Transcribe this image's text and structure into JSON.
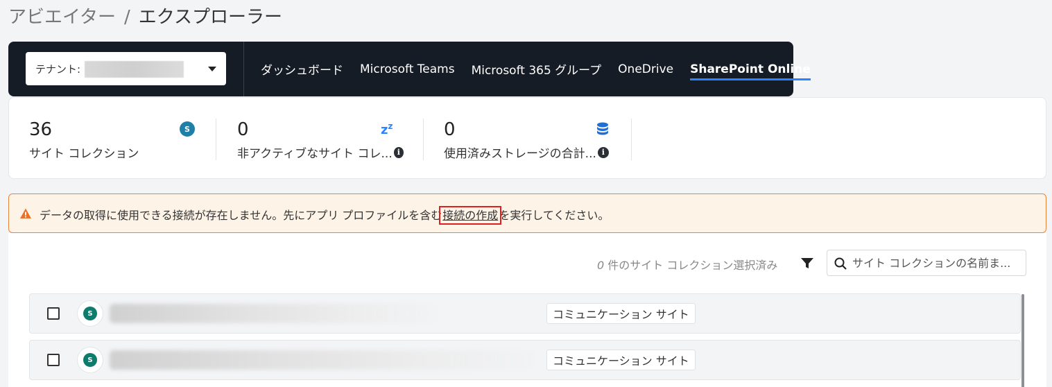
{
  "breadcrumb": {
    "parent": "アビエイター",
    "separator": "/",
    "current": "エクスプローラー"
  },
  "tenant": {
    "label": "テナント:",
    "value": ""
  },
  "nav": {
    "tabs": [
      {
        "label": "ダッシュボード",
        "active": false
      },
      {
        "label": "Microsoft Teams",
        "active": false
      },
      {
        "label": "Microsoft 365 グループ",
        "active": false
      },
      {
        "label": "OneDrive",
        "active": false
      },
      {
        "label": "SharePoint Online",
        "active": true
      }
    ]
  },
  "stats": [
    {
      "value": "36",
      "label": "サイト コレクション",
      "icon": "sharepoint-icon",
      "info": false
    },
    {
      "value": "0",
      "label": "非アクティブなサイト コレ...",
      "icon": "sleep-icon",
      "info": true
    },
    {
      "value": "0",
      "label": "使用済みストレージの合計...",
      "icon": "database-icon",
      "info": true
    }
  ],
  "alert": {
    "text_before": "データの取得に使用できる接続が存在しません。先にアプリ プロファイルを含む",
    "link": "接続の作成",
    "text_after": "を実行してください。"
  },
  "toolbar": {
    "selected_count": "0",
    "selected_suffix": "件のサイト コレクション選択済み",
    "search_placeholder": "サイト コレクションの名前ま..."
  },
  "rows": [
    {
      "name": "",
      "type": "コミュニケーション サイト",
      "checked": false
    },
    {
      "name": "",
      "type": "コミュニケーション サイト",
      "checked": false
    }
  ],
  "colors": {
    "topbar_bg": "#161c25",
    "accent": "#2b84ff",
    "alert_bg": "#fdf3e7",
    "alert_border": "#e8833a",
    "highlight": "#e02020"
  }
}
